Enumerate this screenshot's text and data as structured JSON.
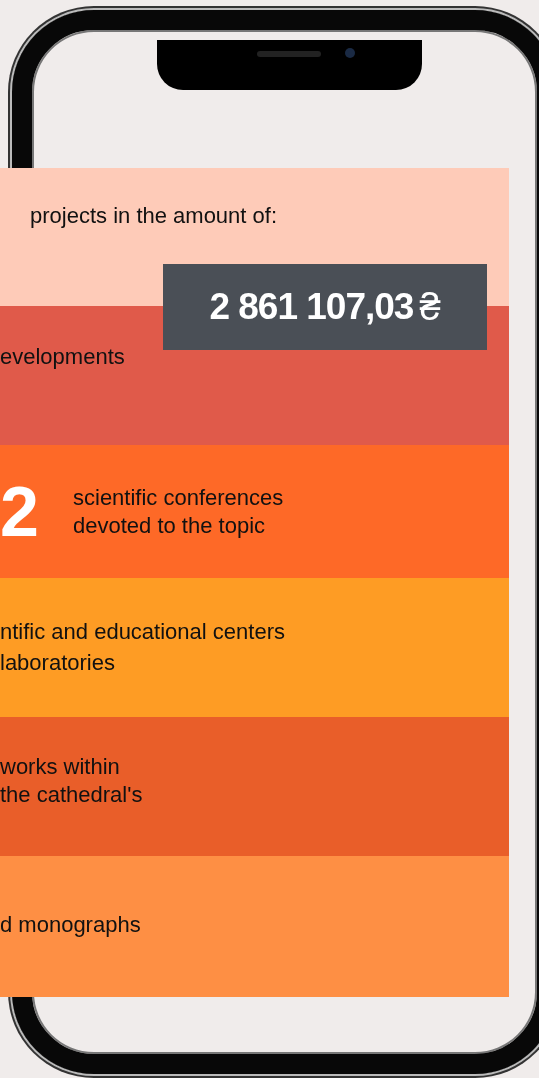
{
  "bands": [
    {
      "kind": "amount",
      "color": "#fecbb8",
      "lines": [
        "projects in the amount of:"
      ],
      "amount": "2 861 107,03",
      "currency": "₴"
    },
    {
      "kind": "text",
      "color": "#e05a4a",
      "lines": [
        "evelopments"
      ]
    },
    {
      "kind": "number",
      "color": "#fe6927",
      "number": "2",
      "lines": [
        "scientific conferences",
        "devoted to the topic"
      ]
    },
    {
      "kind": "text",
      "color": "#fe9c24",
      "lines": [
        "ntific and educational centers",
        "laboratories"
      ]
    },
    {
      "kind": "text",
      "color": "#e95e29",
      "lines": [
        "works within",
        "the cathedral's"
      ]
    },
    {
      "kind": "text",
      "color": "#fe8f44",
      "lines": [
        "d monographs"
      ]
    }
  ]
}
